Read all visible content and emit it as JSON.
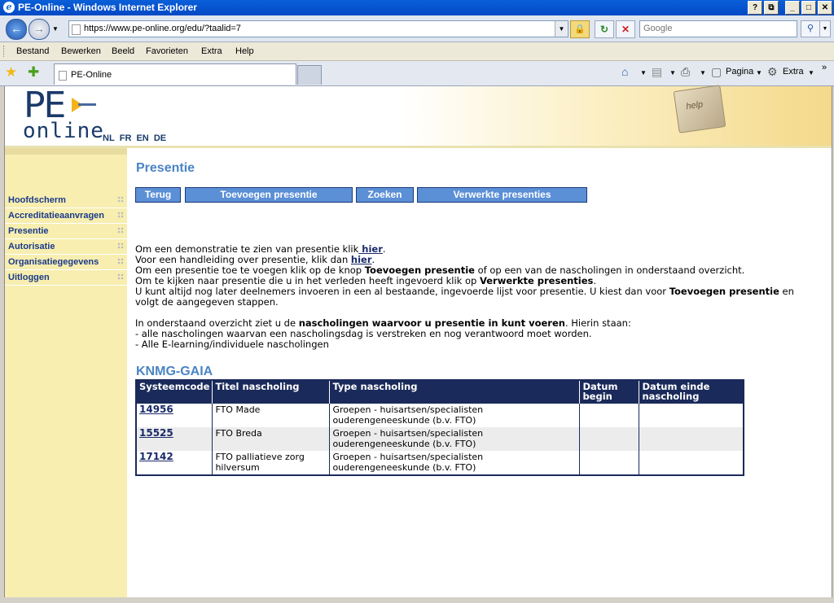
{
  "window": {
    "title": "PE-Online - Windows Internet Explorer",
    "min": "_",
    "max": "□",
    "close": "✕",
    "restore": "⧉",
    "help": "?"
  },
  "address": {
    "url": "https://www.pe-online.org/edu/?taalid=7",
    "search_placeholder": "Google"
  },
  "menu": {
    "items": [
      "Bestand",
      "Bewerken",
      "Beeld",
      "Favorieten",
      "Extra",
      "Help"
    ]
  },
  "tab": {
    "label": "PE-Online"
  },
  "toolbar": {
    "page_label": "Pagina",
    "tools_label": "Extra"
  },
  "banner": {
    "logo_top": "PE",
    "logo_bottom": "online",
    "languages": [
      "NL",
      "FR",
      "EN",
      "DE"
    ],
    "key_text": "help"
  },
  "sidebar": {
    "items": [
      "Hoofdscherm",
      "Accreditatieaanvragen",
      "Presentie",
      "Autorisatie",
      "Organisatiegegevens",
      "Uitloggen"
    ]
  },
  "main": {
    "title": "Presentie",
    "buttons": [
      "Terug",
      "Toevoegen presentie",
      "Zoeken",
      "Verwerkte presenties"
    ],
    "intro": {
      "l1_pre": "Om een demonstratie te zien van presentie klik",
      "l1_link": " hier",
      "l1_post": ".",
      "l2_pre": "Voor een handleiding over presentie, klik dan ",
      "l2_link": "hier",
      "l2_post": ".",
      "l3_pre": "Om een presentie toe te voegen klik op de knop ",
      "l3_bold": "Toevoegen presentie",
      "l3_post": " of op een van de nascholingen in onderstaand overzicht.",
      "l4_pre": "Om te kijken naar presentie die u in het verleden heeft ingevoerd klik op ",
      "l4_bold": "Verwerkte presenties",
      "l4_post": ".",
      "l5_pre": "U kunt altijd nog later deelnemers invoeren in een al bestaande, ingevoerde lijst voor presentie. U kiest dan voor ",
      "l5_bold": "Toevoegen presentie",
      "l5_post": " en",
      "l6": "volgt de aangegeven stappen.",
      "l7_pre": "In onderstaand overzicht ziet u de ",
      "l7_bold": "nascholingen waarvoor u presentie in kunt voeren",
      "l7_post": ". Hierin staan:",
      "l8": "- alle nascholingen waarvan een nascholingsdag is verstreken en nog verantwoord moet worden.",
      "l9": "- Alle E-learning/individuele nascholingen"
    },
    "section_title": "KNMG-GAIA",
    "table": {
      "headers": [
        "Systeemcode",
        "Titel nascholing",
        "Type nascholing",
        "Datum begin",
        "Datum einde nascholing"
      ],
      "rows": [
        {
          "code": "14956",
          "title": "FTO Made",
          "type": "Groepen - huisartsen/specialisten ouderengeneeskunde (b.v. FTO)",
          "begin": "",
          "end": ""
        },
        {
          "code": "15525",
          "title": "FTO Breda",
          "type": "Groepen - huisartsen/specialisten ouderengeneeskunde (b.v. FTO)",
          "begin": "",
          "end": ""
        },
        {
          "code": "17142",
          "title": "FTO palliatieve zorg hilversum",
          "type": "Groepen - huisartsen/specialisten ouderengeneeskunde (b.v. FTO)",
          "begin": "",
          "end": ""
        }
      ]
    }
  }
}
